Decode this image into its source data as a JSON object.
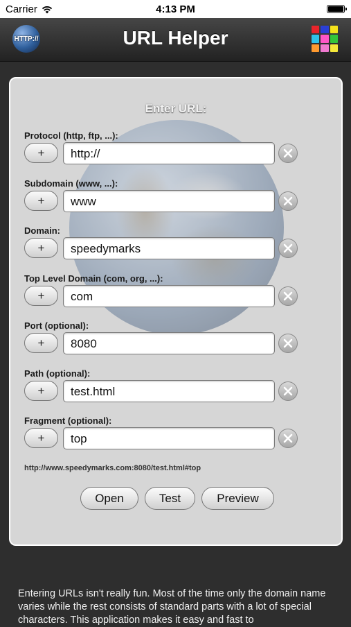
{
  "status_bar": {
    "carrier": "Carrier",
    "time": "4:13 PM"
  },
  "nav": {
    "title": "URL Helper",
    "logo_text": "HTTP://"
  },
  "panel": {
    "title": "Enter URL:",
    "fields": [
      {
        "label": "Protocol (http, ftp, ...):",
        "value": "http://"
      },
      {
        "label": "Subdomain (www, ...):",
        "value": "www"
      },
      {
        "label": "Domain:",
        "value": "speedymarks"
      },
      {
        "label": "Top Level Domain (com, org, ...):",
        "value": "com"
      },
      {
        "label": "Port (optional):",
        "value": "8080"
      },
      {
        "label": "Path (optional):",
        "value": "test.html"
      },
      {
        "label": "Fragment (optional):",
        "value": "top"
      }
    ],
    "plus_label": "+",
    "url_preview": "http://www.speedymarks.com:8080/test.html#top",
    "buttons": {
      "open": "Open",
      "test": "Test",
      "preview": "Preview"
    }
  },
  "description": "Entering URLs isn't really fun. Most of the time only the domain name varies while the rest consists of standard parts with a lot of special characters. This application makes it easy and fast to",
  "colors": {
    "apps_icon": [
      "#e8252b",
      "#2a3fd6",
      "#f5e21b",
      "#2fc3e8",
      "#ff56c7",
      "#34c43a",
      "#ff9a2f",
      "#f07ad0",
      "#f4e83a"
    ]
  }
}
